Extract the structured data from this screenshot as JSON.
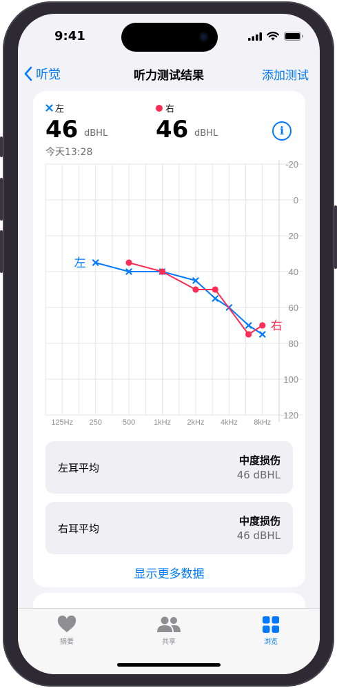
{
  "status": {
    "time": "9:41"
  },
  "nav": {
    "back_label": "听觉",
    "title": "听力测试结果",
    "add_label": "添加测试"
  },
  "summary": {
    "left_legend": "左",
    "right_legend": "右",
    "left_value": "46",
    "right_value": "46",
    "unit": "dBHL",
    "date": "今天13:28"
  },
  "chart_data": {
    "type": "line",
    "x_tick_labels": [
      "125Hz",
      "250",
      "500",
      "1kHz",
      "2kHz",
      "4kHz",
      "8kHz"
    ],
    "y_tick_labels": [
      "-20",
      "0",
      "20",
      "40",
      "60",
      "80",
      "100",
      "120"
    ],
    "ylim": [
      -20,
      120
    ],
    "y_inverted": true,
    "series": [
      {
        "name": "左",
        "color": "#007aff",
        "marker": "x",
        "points": [
          [
            250,
            35
          ],
          [
            500,
            40
          ],
          [
            1000,
            40
          ],
          [
            2000,
            45
          ],
          [
            3000,
            55
          ],
          [
            4000,
            60
          ],
          [
            6000,
            70
          ],
          [
            8000,
            75
          ]
        ]
      },
      {
        "name": "右",
        "color": "#ff2d55",
        "marker": "circle",
        "points": [
          [
            500,
            35
          ],
          [
            1000,
            40
          ],
          [
            2000,
            50
          ],
          [
            3000,
            50
          ],
          [
            6000,
            75
          ],
          [
            8000,
            70
          ]
        ]
      }
    ]
  },
  "left_avg": {
    "label": "左耳平均",
    "status": "中度损伤",
    "value": "46 dBHL"
  },
  "right_avg": {
    "label": "右耳平均",
    "status": "中度损伤",
    "value": "46 dBHL"
  },
  "more_label": "显示更多数据",
  "tabs": [
    {
      "label": "摘要",
      "icon": "heart-icon",
      "active": false
    },
    {
      "label": "共享",
      "icon": "people-icon",
      "active": false
    },
    {
      "label": "浏览",
      "icon": "grid-icon",
      "active": true
    }
  ],
  "colors": {
    "accent": "#007aff",
    "left": "#007aff",
    "right": "#ff2d55"
  }
}
